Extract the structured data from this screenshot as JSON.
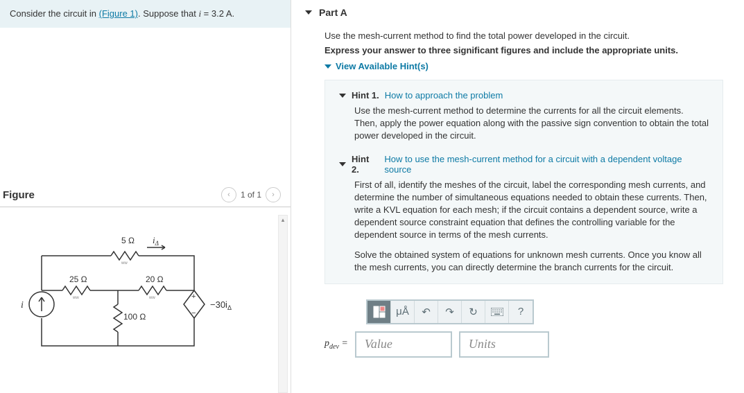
{
  "problem": {
    "prefix": "Consider the circuit in ",
    "figure_link": "(Figure 1)",
    "suffix1": ". Suppose that ",
    "var": "i",
    "suffix2": " = 3.2 A."
  },
  "figure": {
    "title": "Figure",
    "counter": "1 of 1",
    "labels": {
      "r1": "5 Ω",
      "r2": "25 Ω",
      "r3": "20 Ω",
      "r4": "100 Ω",
      "cs": "i",
      "dep": "−30i",
      "idelta": "iΔ",
      "depsub": "Δ"
    }
  },
  "part": {
    "title": "Part A",
    "instruction": "Use the mesh-current method to find the total power developed in the circuit.",
    "instruction_bold": "Express your answer to three significant figures and include the appropriate units.",
    "hints_toggle": "View Available Hint(s)"
  },
  "hints": [
    {
      "label": "Hint 1.",
      "title": "How to approach the problem",
      "body": [
        "Use the mesh-current method to determine the currents for all the circuit elements. Then, apply the power equation along with the passive sign convention to obtain the total power developed in the circuit."
      ]
    },
    {
      "label": "Hint 2.",
      "title": "How to use the mesh-current method for a circuit with a dependent voltage source",
      "body": [
        "First of all, identify the meshes of the circuit, label the corresponding mesh currents, and determine the number of simultaneous equations needed to obtain these currents. Then, write a KVL equation for each mesh; if the circuit contains a dependent source, write a dependent source constraint equation that defines the controlling variable for the dependent source in terms of the mesh currents.",
        "Solve the obtained system of equations for unknown mesh currents. Once you know all the mesh currents, you can directly determine the branch currents for the circuit."
      ]
    }
  ],
  "toolbar": {
    "special": "μÅ",
    "help": "?"
  },
  "answer": {
    "lhs": "p",
    "lhs_sub": "dev",
    "eq": " = ",
    "value_placeholder": "Value",
    "units_placeholder": "Units"
  }
}
